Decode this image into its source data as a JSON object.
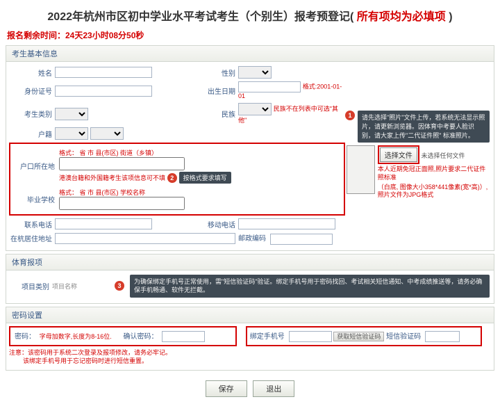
{
  "title": {
    "main": "2022年杭州市区初中学业水平考试考生（个别生）报考预登记(",
    "highlight": " 所有项均为必填项 ",
    "end": ")"
  },
  "countdown": "报名剩余时间：24天23小时08分50秒",
  "section": {
    "basic": "考生基本信息",
    "sports": "体育报项",
    "password": "密码设置"
  },
  "labels": {
    "name": "姓名",
    "gender": "性别",
    "idno": "身份证号",
    "birth": "出生日期",
    "birth_hint": "格式:2001-01-01",
    "stu_type": "考生类别",
    "nation": "民族",
    "nation_hint": "民族不在列表中可选\"其他\"",
    "hukou": "户籍",
    "hukou_place": "户口所在地",
    "grad_school": "毕业学校",
    "hukou_fmt1": "格式：    省   市    县(市区)    街道（乡镇）",
    "hukou_note": "港澳台籍和外国籍考生该项信息可不填",
    "school_fmt": "格式：    省   市    县(市区)    学校名称",
    "tooltip_fmt": "按格式要求填写",
    "contact": "联系电话",
    "mobile": "移动电话",
    "address": "在杭居住地址",
    "postcode": "邮政编码",
    "proj_type": "项目类别",
    "proj_name": "项目名称",
    "password": "密码：",
    "pwd_hint": "字母加数字,长度为8-16位.",
    "confirm_pwd": "确认密码：",
    "bind_phone": "绑定手机号",
    "sms_btn": "获取短信验证码",
    "sms_code": "短信验证码",
    "file_btn": "选择文件",
    "file_none": "未选择任何文件"
  },
  "tips": {
    "photo1": "请先选择\"照片\"文件上传，若系统无法显示照片，请更新浏览器。因体育中考要人脸识别，请大家上传\"二代证件照\" 标准照片。",
    "photo2a": "本人近期免冠正面照,照片要求二代证件照标准",
    "photo2b": "（白底, 图像大小358*441像素(宽*高)）, 照片文件为JPG格式",
    "sms_tip": "为确保绑定手机号正常使用，需\"短信验证码\"验证。绑定手机号用于密码找回、考试相关短信通知、中考成绩推送等，请务必确保手机畅通、软件无拦截。"
  },
  "warn": {
    "l1": "注意：该密码用于系统二次登录及报项修改，请务必牢记。",
    "l2": "        该绑定手机号用于忘记密码时进行短信重置。"
  },
  "buttons": {
    "save": "保存",
    "exit": "退出"
  },
  "badges": {
    "b1": "1",
    "b2": "2",
    "b3": "3"
  }
}
